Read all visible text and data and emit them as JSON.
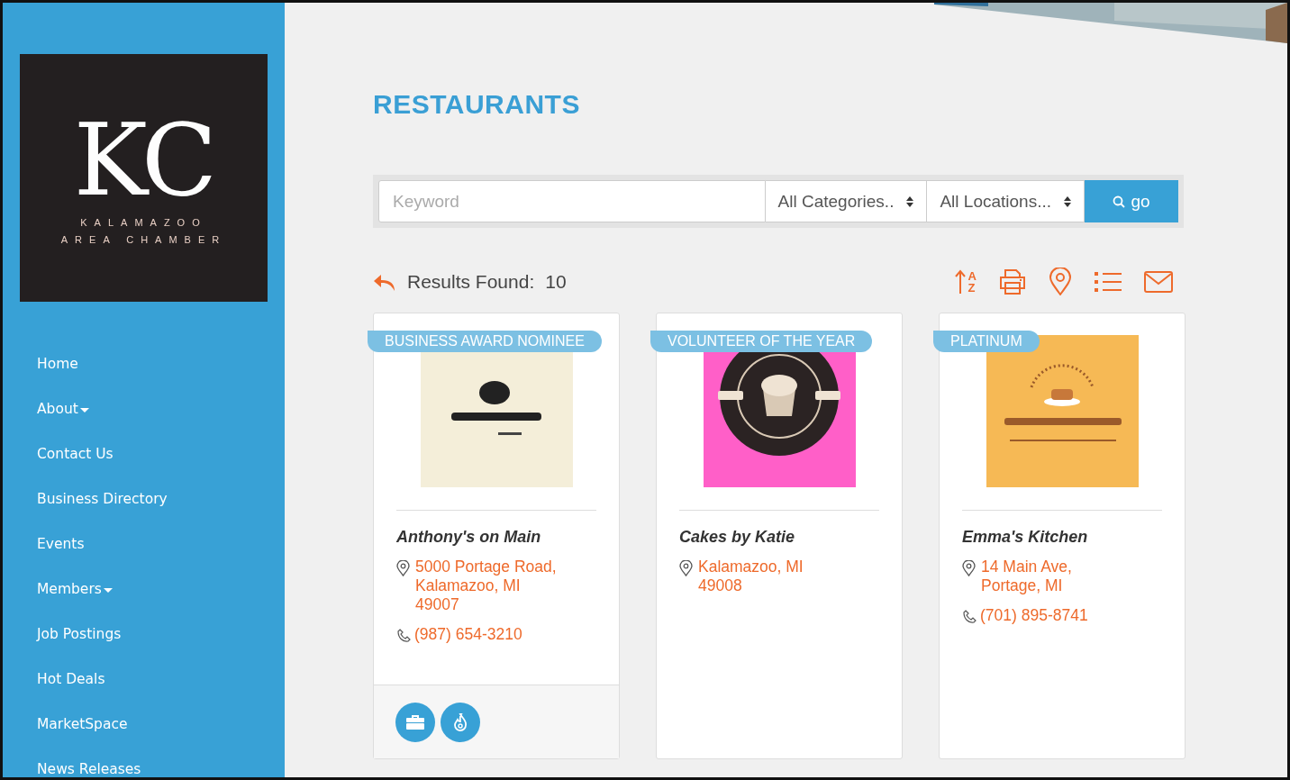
{
  "logo": {
    "letters": "KC",
    "line_1": "KALAMAZOO",
    "line_2": "AREA CHAMBER"
  },
  "nav": [
    {
      "label": "Home",
      "has_menu": false
    },
    {
      "label": "About",
      "has_menu": true
    },
    {
      "label": "Contact Us",
      "has_menu": false
    },
    {
      "label": "Business Directory",
      "has_menu": false
    },
    {
      "label": "Events",
      "has_menu": false
    },
    {
      "label": "Members",
      "has_menu": true
    },
    {
      "label": "Job Postings",
      "has_menu": false
    },
    {
      "label": "Hot Deals",
      "has_menu": false
    },
    {
      "label": "MarketSpace",
      "has_menu": false
    },
    {
      "label": "News Releases",
      "has_menu": false
    }
  ],
  "header_image": {
    "kind": "picture"
  },
  "title": "RESTAURANTS",
  "search": {
    "placeholder": "Keyword",
    "category": "All Categories..",
    "location": "All Locations...",
    "button": "go"
  },
  "results": {
    "label": "Results Found:",
    "count": "10"
  },
  "toolbar": [
    {
      "kind": "sort",
      "letters": [
        "A",
        "Z"
      ]
    },
    {
      "kind": "print"
    },
    {
      "kind": "map"
    },
    {
      "kind": "list"
    },
    {
      "kind": "email"
    }
  ],
  "cards": [
    {
      "badge": "BUSINESS AWARD NOMINEE",
      "image": {
        "kind": "picture"
      },
      "name": "Anthony's on Main",
      "address_lines": [
        "5000 Portage Road,",
        "Kalamazoo, MI",
        "49007"
      ],
      "phone": "(987) 654-3210",
      "actions": [
        {
          "kind": "briefcase"
        },
        {
          "kind": "flame"
        }
      ]
    },
    {
      "badge": "VOLUNTEER OF THE YEAR",
      "image": {
        "kind": "picture"
      },
      "name": "Cakes by Katie",
      "address_lines": [
        "Kalamazoo, MI",
        "49008"
      ]
    },
    {
      "badge": "PLATINUM",
      "image": {
        "kind": "picture"
      },
      "name": "Emma's Kitchen",
      "address_lines": [
        "14 Main Ave,",
        "Portage, MI"
      ],
      "phone": "(701) 895-8741"
    }
  ]
}
